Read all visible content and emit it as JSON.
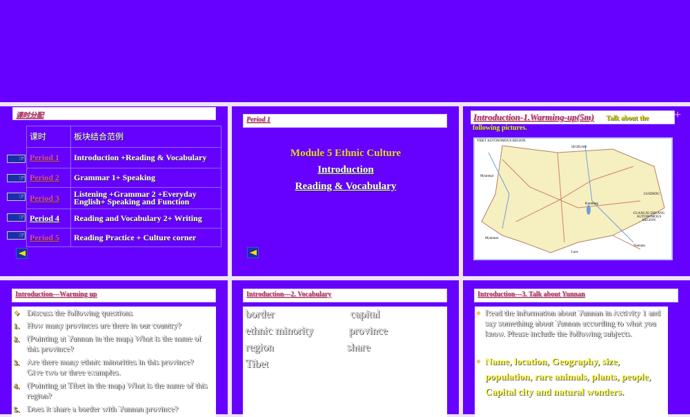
{
  "slide1": {
    "title": "课时分配",
    "header": [
      "课时",
      "板块结合范例"
    ],
    "rows": [
      {
        "period": "Period 1",
        "content": "Introduction +Reading & Vocabulary"
      },
      {
        "period": "Period 2",
        "content": "Grammar 1+ Speaking"
      },
      {
        "period": "Period 3",
        "content": "Listening +Grammar 2 +Everyday English+ Speaking and Function"
      },
      {
        "period": "Period 4",
        "content": "Reading and Vocabulary 2+ Writing"
      },
      {
        "period": "Period 5",
        "content": "Reading Practice + Culture corner"
      }
    ]
  },
  "slide2": {
    "title": "Period 1",
    "line1": "Module 5 Ethnic Culture",
    "line2": "Introduction",
    "line3": "Reading & Vocabulary"
  },
  "slide3": {
    "title": "Introduction-1.Warming-up(5m)",
    "subtitle_a": "Talk about the",
    "subtitle_b": "following pictures.",
    "map_labels": [
      "TIBET AUTONOMOUS REGION",
      "SICHUAN",
      "Myanmar",
      "Kunming",
      "GUIZHOU",
      "GUANGXI ZHUANG AUTONOMOUS REGION",
      "Myanmar",
      "Vietnam",
      "Laos"
    ]
  },
  "slide4": {
    "title": "Introduction---Warming up",
    "intro": "Discuss the following questions",
    "questions": [
      "How many provinces are there in our country?",
      "(Pointing at Yunnan in the map) What is the name of this province?",
      "Are there many ethnic minorities in this province? Give two or three examples.",
      "(Pointing at Tibet in the map) What is the name of this region?",
      "Does it share a border with Yunnan province?"
    ]
  },
  "slide5": {
    "title": "Introduction---2. Vocabulary",
    "words": [
      "border",
      "capital",
      "ethnic minority",
      "province",
      "region",
      "share",
      "Tibet"
    ]
  },
  "slide6": {
    "title": "Introduction---3. Talk about Yunnan",
    "para": "Read the information about Yunnan in Activity 1 and say something about Yunnan according to what you know. Please include the following subjects.",
    "subjects": "Name, location, Geography, size, population, rare animals, plants, people, Capital city and natural wonders."
  },
  "colors": {
    "slide_bg": "#6600ff",
    "gap": "#efe3f6",
    "period_link": "#e040c8",
    "accent_yellow": "#ffe000"
  }
}
